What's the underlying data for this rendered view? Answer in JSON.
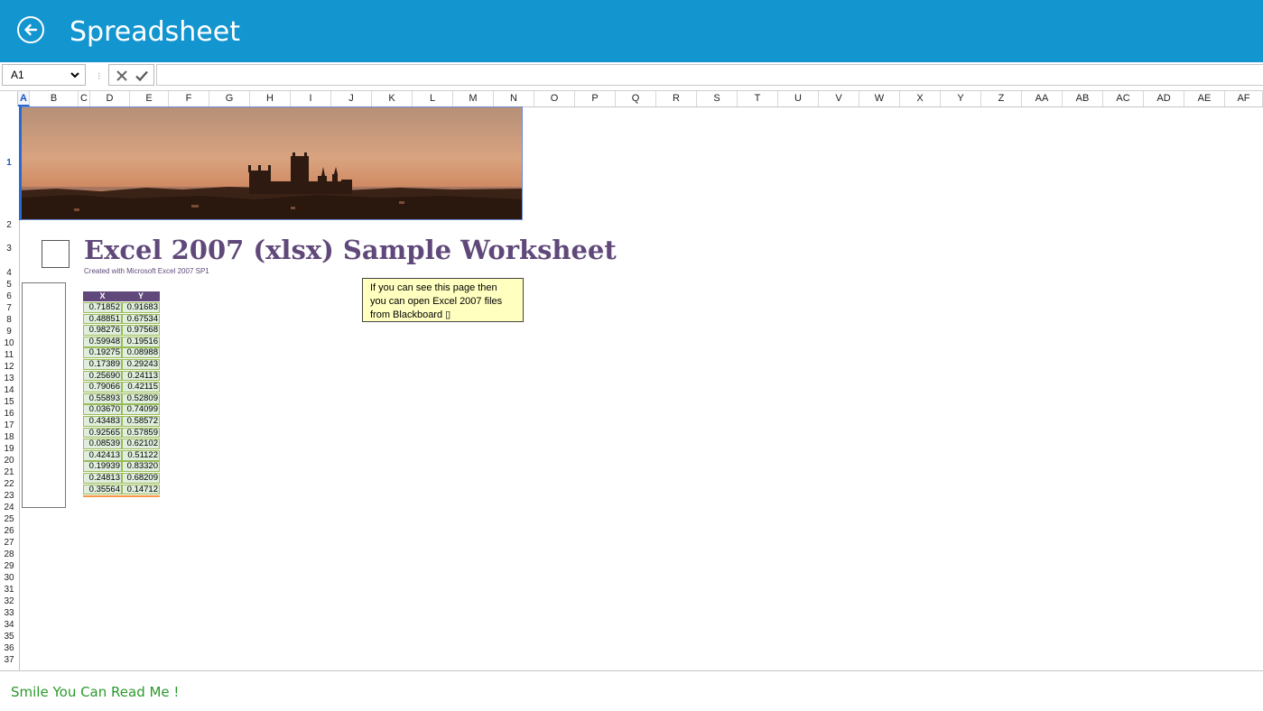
{
  "app": {
    "title": "Spreadsheet"
  },
  "formula_bar": {
    "cell_ref": "A1",
    "separator": "⁝",
    "formula": ""
  },
  "columns": [
    "A",
    "B",
    "C",
    "D",
    "E",
    "F",
    "G",
    "H",
    "I",
    "J",
    "K",
    "L",
    "M",
    "N",
    "O",
    "P",
    "Q",
    "R",
    "S",
    "T",
    "U",
    "V",
    "W",
    "X",
    "Y",
    "Z",
    "AA",
    "AB",
    "AC",
    "AD",
    "AE",
    "AF"
  ],
  "selected_column": "A",
  "rows": [
    "1",
    "2",
    "3",
    "4",
    "5",
    "6",
    "7",
    "8",
    "9",
    "10",
    "11",
    "12",
    "13",
    "14",
    "15",
    "16",
    "17",
    "18",
    "19",
    "20",
    "21",
    "22",
    "23",
    "24",
    "25",
    "26",
    "27",
    "28",
    "29",
    "30",
    "31",
    "32",
    "33",
    "34",
    "35",
    "36",
    "37"
  ],
  "selected_row": "1",
  "worksheet": {
    "title": "Excel 2007 (xlsx) Sample Worksheet",
    "subtitle": "Created with Microsoft Excel 2007 SP1"
  },
  "note": {
    "lines": [
      "If you can see this page then",
      "you can open Excel 2007 files",
      "from Blackboard ▯"
    ]
  },
  "table": {
    "headers": [
      "X",
      "Y"
    ],
    "rows": [
      [
        "0.71852",
        "0.91683"
      ],
      [
        "0.48851",
        "0.67534"
      ],
      [
        "0.98276",
        "0.97568"
      ],
      [
        "0.59948",
        "0.19516"
      ],
      [
        "0.19275",
        "0.08988"
      ],
      [
        "0.17389",
        "0.29243"
      ],
      [
        "0.25690",
        "0.24113"
      ],
      [
        "0.79066",
        "0.42115"
      ],
      [
        "0.55893",
        "0.52809"
      ],
      [
        "0.03670",
        "0.74099"
      ],
      [
        "0.43483",
        "0.58572"
      ],
      [
        "0.92565",
        "0.57859"
      ],
      [
        "0.08539",
        "0.62102"
      ],
      [
        "0.42413",
        "0.51122"
      ],
      [
        "0.19939",
        "0.83320"
      ],
      [
        "0.24813",
        "0.68209"
      ],
      [
        "0.35564",
        "0.14712"
      ]
    ]
  },
  "status": {
    "message": "Smile You Can Read Me !"
  },
  "colors": {
    "titlebar": "#1395d0",
    "accent_purple": "#60497a",
    "table_green": "#dfeedd",
    "status_green": "#2a9a2a"
  }
}
